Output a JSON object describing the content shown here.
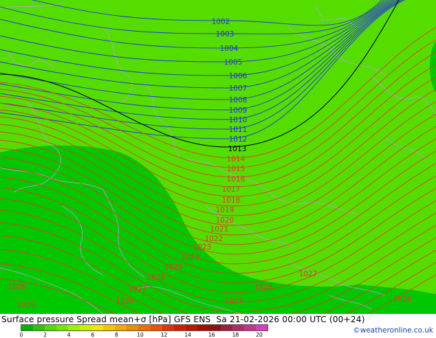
{
  "title": "Surface pressure Spread mean+σ [hPa] GFS ENS  Sa 21-02-2026 00:00 UTC (00+24)",
  "credit": "©weatheronline.co.uk",
  "colors": {
    "field_light": "#55dd00",
    "field_dark": "#00c800",
    "isobar_low": "#2233dd",
    "isobar_ref": "#000000",
    "isobar_high": "#e03c2a",
    "coast": "#a8a8c8"
  },
  "legend": {
    "ticks": [
      "0",
      "2",
      "4",
      "6",
      "8",
      "10",
      "12",
      "14",
      "16",
      "18",
      "20"
    ],
    "colors": [
      "#00b400",
      "#28c800",
      "#50dc00",
      "#78e600",
      "#a0f000",
      "#c8f000",
      "#f0e600",
      "#f0c800",
      "#f0aa00",
      "#f08c00",
      "#f06e00",
      "#f05000",
      "#e63200",
      "#d21e00",
      "#be1400",
      "#aa0a00",
      "#960a14",
      "#a01e3c",
      "#b42864",
      "#c8328c",
      "#dc3cb4"
    ]
  },
  "isobar_labels": [
    {
      "text": "1002"
    },
    {
      "text": "1003"
    },
    {
      "text": "1004"
    },
    {
      "text": "1005"
    },
    {
      "text": "1006"
    },
    {
      "text": "1007"
    },
    {
      "text": "1008"
    },
    {
      "text": "1009"
    },
    {
      "text": "1010"
    },
    {
      "text": "1011"
    },
    {
      "text": "1012"
    },
    {
      "text": "1013"
    },
    {
      "text": "1014"
    },
    {
      "text": "1015"
    },
    {
      "text": "1016"
    },
    {
      "text": "1017"
    },
    {
      "text": "1018"
    },
    {
      "text": "1019"
    },
    {
      "text": "1020"
    },
    {
      "text": "1021"
    },
    {
      "text": "1022"
    },
    {
      "text": "1023"
    },
    {
      "text": "1024"
    },
    {
      "text": "1025"
    },
    {
      "text": "1026"
    },
    {
      "text": "1027"
    },
    {
      "text": "1028"
    },
    {
      "text": "1029"
    },
    {
      "text": "1026"
    },
    {
      "text": "1027"
    },
    {
      "text": "1028"
    },
    {
      "text": "1028"
    },
    {
      "text": "1027"
    },
    {
      "text": "1026"
    }
  ]
}
